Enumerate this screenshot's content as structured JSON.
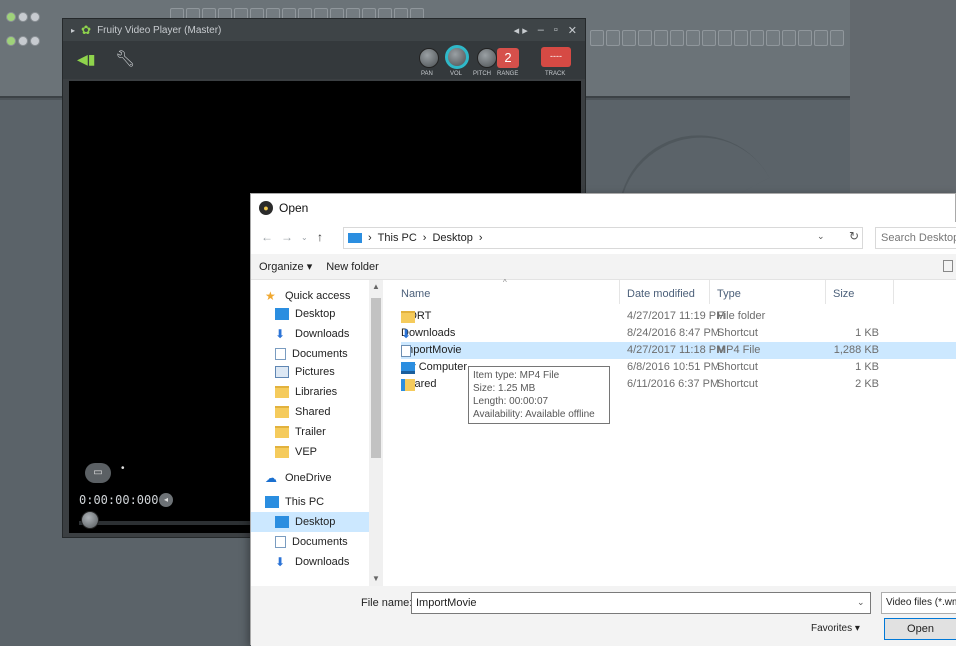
{
  "fvp": {
    "title": "Fruity Video Player (Master)",
    "knob_labels": [
      "PAN",
      "VOL",
      "PITCH",
      "RANGE",
      "TRACK"
    ],
    "range_value": "2",
    "track_value": "----",
    "timecode": "0:00:00:000"
  },
  "dialog": {
    "title": "Open",
    "address": [
      "This PC",
      "Desktop"
    ],
    "search_placeholder": "Search Desktop",
    "organize_label": "Organize ▾",
    "new_folder_label": "New folder",
    "nav_items": [
      {
        "label": "Quick access",
        "icon": "star"
      },
      {
        "label": "Desktop",
        "icon": "blue",
        "pinned": true
      },
      {
        "label": "Downloads",
        "icon": "dl",
        "pinned": true
      },
      {
        "label": "Documents",
        "icon": "doc",
        "pinned": true
      },
      {
        "label": "Pictures",
        "icon": "pic",
        "pinned": true
      },
      {
        "label": "Libraries",
        "icon": "folder"
      },
      {
        "label": "Shared",
        "icon": "folder"
      },
      {
        "label": "Trailer",
        "icon": "folder"
      },
      {
        "label": "VEP",
        "icon": "folder"
      },
      {
        "label": "OneDrive",
        "icon": "cloud"
      },
      {
        "label": "This PC",
        "icon": "blue"
      },
      {
        "label": "Desktop",
        "icon": "blue",
        "selected": true
      },
      {
        "label": "Documents",
        "icon": "doc"
      },
      {
        "label": "Downloads",
        "icon": "dl"
      }
    ],
    "columns": {
      "name": "Name",
      "date": "Date modified",
      "type": "Type",
      "size": "Size"
    },
    "files": [
      {
        "name": "SORT",
        "date": "4/27/2017 11:19 PM",
        "type": "File folder",
        "size": "",
        "icon": "folder"
      },
      {
        "name": "Downloads",
        "date": "8/24/2016 8:47 PM",
        "type": "Shortcut",
        "size": "1 KB",
        "icon": "dl"
      },
      {
        "name": "ImportMovie",
        "date": "4/27/2017 11:18 PM",
        "type": "MP4 File",
        "size": "1,288 KB",
        "icon": "mp4",
        "selected": true
      },
      {
        "name": "My Computer",
        "date": "6/8/2016 10:51 PM",
        "type": "Shortcut",
        "size": "1 KB",
        "icon": "pcico"
      },
      {
        "name": "Shared",
        "date": "6/11/2016 6:37 PM",
        "type": "Shortcut",
        "size": "2 KB",
        "icon": "shared"
      }
    ],
    "tooltip": [
      "Item type: MP4 File",
      "Size: 1.25 MB",
      "Length: 00:00:07",
      "Availability: Available offline"
    ],
    "file_name_label": "File name:",
    "file_name_value": "ImportMovie",
    "filter_value": "Video files (*.wmv",
    "favorites_label": "Favorites ▾",
    "open_label": "Open"
  }
}
